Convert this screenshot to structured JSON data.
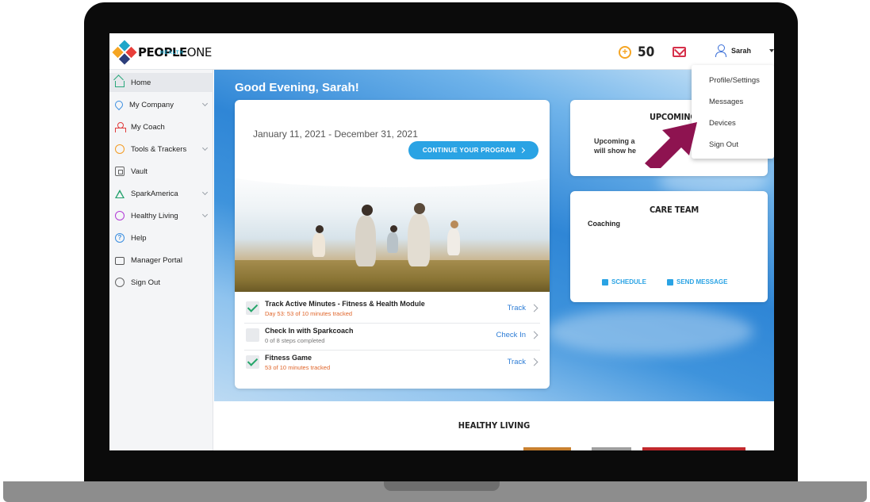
{
  "brand": {
    "name_bold": "PEOPLE",
    "name_light": "ONE",
    "sub": "HEALTH"
  },
  "header": {
    "points": "50",
    "user_name": "Sarah"
  },
  "sidebar": {
    "items": [
      {
        "label": "Home",
        "icon": "home-icon",
        "active": true
      },
      {
        "label": "My Company",
        "icon": "location-pin-icon",
        "expandable": true
      },
      {
        "label": "My Coach",
        "icon": "coach-person-icon"
      },
      {
        "label": "Tools & Trackers",
        "icon": "tools-icon",
        "expandable": true
      },
      {
        "label": "Vault",
        "icon": "vault-icon"
      },
      {
        "label": "SparkAmerica",
        "icon": "spark-triangle-icon",
        "expandable": true
      },
      {
        "label": "Healthy Living",
        "icon": "healthy-living-icon",
        "expandable": true
      },
      {
        "label": "Help",
        "icon": "help-icon"
      },
      {
        "label": "Manager Portal",
        "icon": "manager-portal-icon"
      },
      {
        "label": "Sign Out",
        "icon": "sign-out-icon"
      }
    ]
  },
  "main": {
    "greeting": "Good Evening, Sarah!",
    "program": {
      "dates": "January 11, 2021 - December 31, 2021",
      "continue_label": "CONTINUE YOUR PROGRAM",
      "tasks": [
        {
          "title": "Track Active Minutes - Fitness & Health Module",
          "subtitle": "Day 53: 53 of 10 minutes tracked",
          "action": "Track",
          "done": true
        },
        {
          "title": "Check In with Sparkcoach",
          "subtitle": "0 of 8 steps completed",
          "action": "Check In",
          "done": false
        },
        {
          "title": "Fitness Game",
          "subtitle": "53 of 10 minutes tracked",
          "action": "Track",
          "done": true
        }
      ]
    },
    "upcoming": {
      "title": "UPCOMING",
      "body_line1": "Upcoming a",
      "body_line2": "will show he"
    },
    "care_team": {
      "title": "CARE TEAM",
      "coaching_label": "Coaching",
      "schedule_label": "SCHEDULE",
      "send_message_label": "SEND MESSAGE"
    },
    "healthy_living_title": "HEALTHY LIVING"
  },
  "dropdown": {
    "items": [
      "Profile/Settings",
      "Messages",
      "Devices",
      "Sign Out"
    ]
  },
  "colors": {
    "accent": "#2aa3e4",
    "callout_arrow": "#8e1350",
    "points": "#f5a523",
    "mail": "#d6304a"
  }
}
